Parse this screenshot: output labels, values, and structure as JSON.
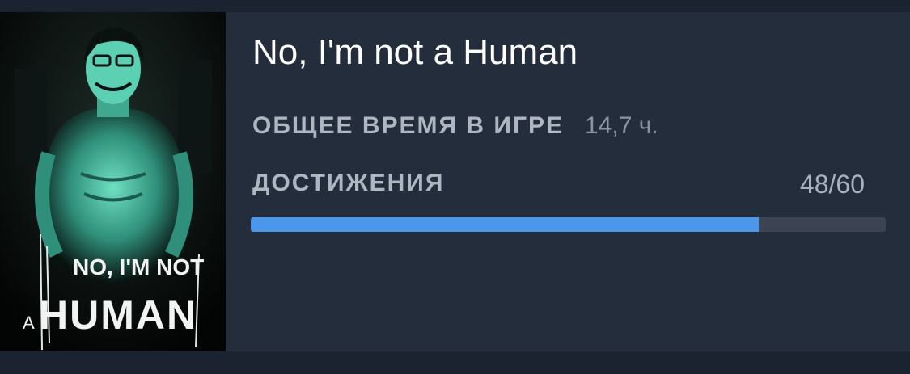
{
  "game": {
    "title": "No, I'm not a Human",
    "cover_icon": "game-cover-art",
    "cover_text": {
      "line1": "NO, I'M NOT",
      "line2_prefix": "A",
      "line2": "HUMAN"
    }
  },
  "stats": {
    "playtime_label": "ОБЩЕЕ ВРЕМЯ В ИГРЕ",
    "playtime_value": "14,7 ч.",
    "achievements_label": "ДОСТИЖЕНИЯ",
    "achievements_count": "48/60",
    "achievements_unlocked": 48,
    "achievements_total": 60
  },
  "colors": {
    "background": "#1b2230",
    "card": "#242d3c",
    "progress_fill": "#4b97ec",
    "progress_track": "#3c4352",
    "cover_glow": "#58c9ad"
  }
}
